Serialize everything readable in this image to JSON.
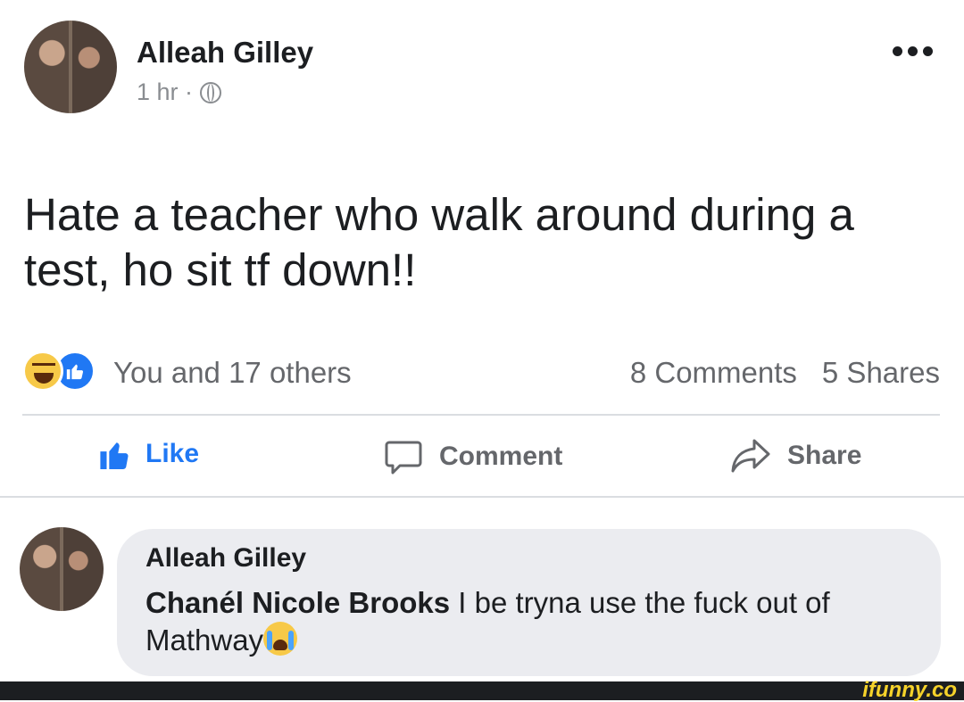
{
  "post": {
    "author": "Alleah Gilley",
    "time": "1 hr ·",
    "text": "Hate a teacher who walk around during a test, ho sit tf down!!",
    "reactions_text": "You and 17 others",
    "comments_count": "8 Comments",
    "shares_count": "5 Shares"
  },
  "actions": {
    "like": "Like",
    "comment": "Comment",
    "share": "Share"
  },
  "comment": {
    "author": "Alleah Gilley",
    "mention": "Chanél Nicole Brooks",
    "text": " I be tryna use the fuck out of Mathway"
  },
  "watermark": "ifunny.co",
  "colors": {
    "accent": "#2078f4",
    "muted": "#65676b",
    "bubble": "#ebecf0"
  }
}
